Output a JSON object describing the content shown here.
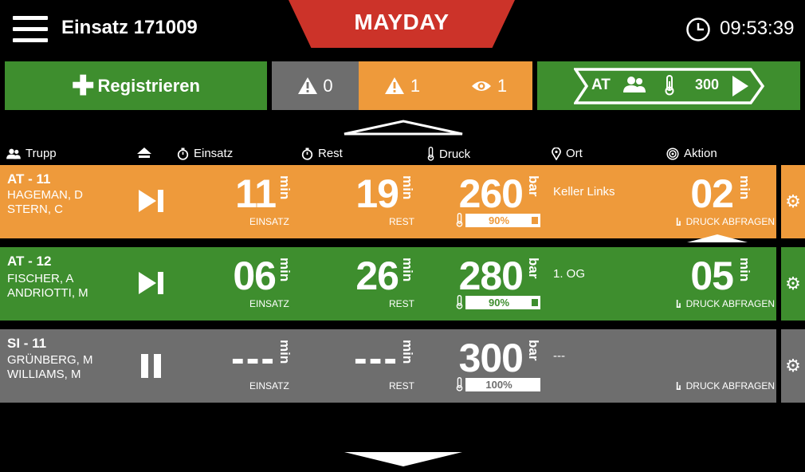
{
  "header": {
    "menu_icon": "hamburger-icon",
    "title": "Einsatz 171009",
    "mayday_label": "MAYDAY",
    "clock_icon": "clock-icon",
    "time": "09:53:39"
  },
  "toolbar": {
    "register_label": "Registrieren",
    "alarm_grey_count": "0",
    "alarm_orange_count": "1",
    "eye_count": "1",
    "at_button": {
      "label": "AT",
      "value": "300"
    }
  },
  "columns": {
    "trupp": "Trupp",
    "einsatz": "Einsatz",
    "rest": "Rest",
    "druck": "Druck",
    "ort": "Ort",
    "aktion": "Aktion"
  },
  "units": {
    "min": "min",
    "bar": "bar"
  },
  "labels": {
    "einsatz": "EINSATZ",
    "rest": "REST",
    "druck_abfragen": "DRUCK ABFRAGEN"
  },
  "rows": [
    {
      "name": "AT - 11",
      "members": [
        "HAGEMAN, D",
        "STERN, C"
      ],
      "control": "skip",
      "einsatz": "11",
      "rest": "19",
      "druck": "260",
      "druck_pct": "90%",
      "druck_fraction": 0.9,
      "ort": "Keller Links",
      "aktion": "02",
      "color": "#ee9a3b",
      "bar_color": "#3e8e2e"
    },
    {
      "name": "AT - 12",
      "members": [
        "FISCHER, A",
        "ANDRIOTTI, M"
      ],
      "control": "skip",
      "einsatz": "06",
      "rest": "26",
      "druck": "280",
      "druck_pct": "90%",
      "druck_fraction": 0.9,
      "ort": "1. OG",
      "aktion": "05",
      "color": "#3e8e2e",
      "bar_color": "#3e8e2e"
    },
    {
      "name": "SI - 11",
      "members": [
        "GRÜNBERG, M",
        "WILLIAMS, M"
      ],
      "control": "pause",
      "einsatz": "---",
      "rest": "---",
      "druck": "300",
      "druck_pct": "100%",
      "druck_fraction": 1.0,
      "ort": "---",
      "aktion": "",
      "color": "#6e6e6e",
      "bar_color": "#6e6e6e"
    }
  ]
}
